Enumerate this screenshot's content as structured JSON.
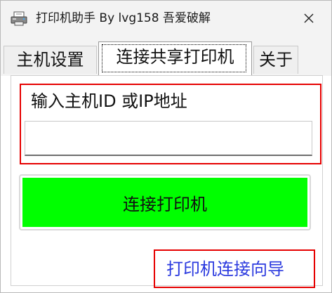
{
  "window": {
    "title": "打印机助手 By lvg158 吾爱破解",
    "app_icon": "printer-app-icon",
    "close_icon": "close-icon"
  },
  "tabs": [
    {
      "label": "主机设置",
      "selected": false
    },
    {
      "label": "连接共享打印机",
      "selected": true
    },
    {
      "label": "关于",
      "selected": false
    }
  ],
  "panel": {
    "input_label": "输入主机ID 或IP地址",
    "input_value": "",
    "input_placeholder": "",
    "connect_button_label": "连接打印机",
    "guide_link_label": "打印机连接向导"
  },
  "colors": {
    "connect_button_fill": "#00ff00",
    "highlight_box": "#e60000",
    "link_text": "#2b3adf"
  }
}
